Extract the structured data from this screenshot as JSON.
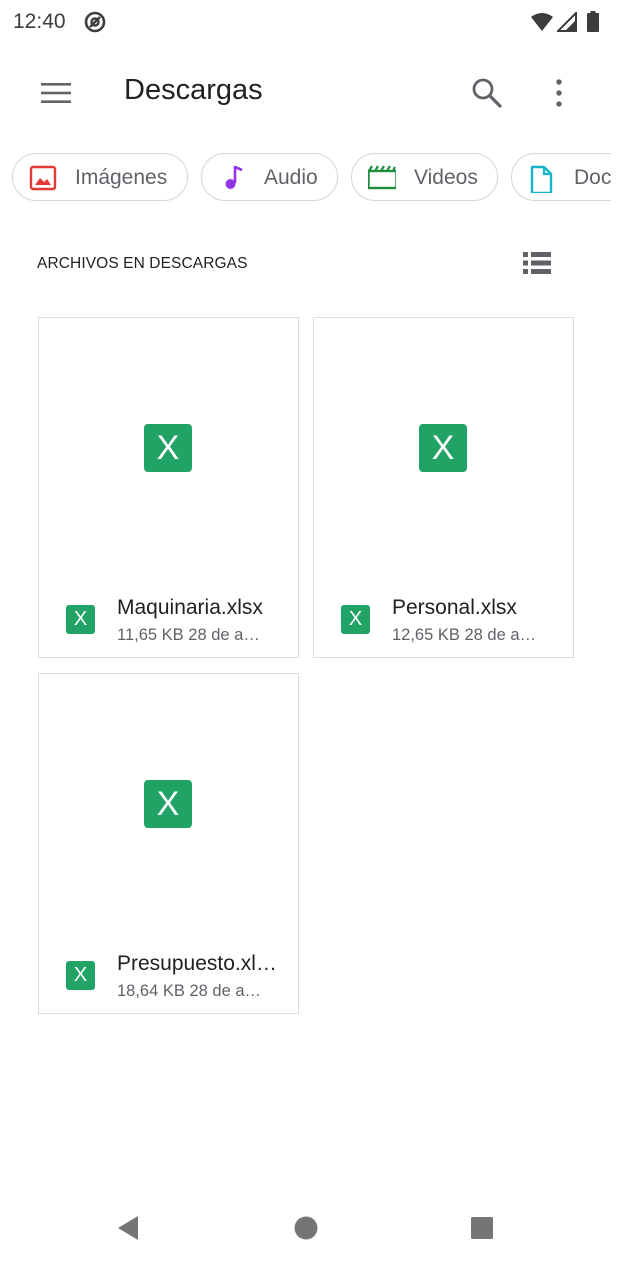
{
  "status_bar": {
    "time": "12:40",
    "icons": [
      "sync-icon",
      "wifi-icon",
      "signal-icon",
      "battery-icon"
    ]
  },
  "app_bar": {
    "title": "Descargas",
    "icons": [
      "menu-icon",
      "search-icon",
      "more-vert-icon"
    ]
  },
  "chips": [
    {
      "label": "Imágenes",
      "icon": "image-icon",
      "color": "#e53935"
    },
    {
      "label": "Audio",
      "icon": "music-note-icon",
      "color": "#9334e6"
    },
    {
      "label": "Videos",
      "icon": "movie-icon",
      "color": "#1e8e3e"
    },
    {
      "label": "Doc",
      "icon": "document-icon",
      "color": "#12b5cb"
    }
  ],
  "section": {
    "title": "ARCHIVOS EN DESCARGAS",
    "view_toggle_icon": "list-view-icon"
  },
  "files": [
    {
      "name": "Maquinaria.xlsx",
      "size": "11,65 KB",
      "date": "28 de a…",
      "icon_letter": "X"
    },
    {
      "name": "Personal.xlsx",
      "size": "12,65 KB",
      "date": "28 de a…",
      "icon_letter": "X"
    },
    {
      "name": "Presupuesto.xl…",
      "size": "18,64 KB",
      "date": "28 de a…",
      "icon_letter": "X"
    }
  ],
  "colors": {
    "excel_green": "#21a366",
    "chip_border": "#d6d6d6",
    "secondary_text": "#5f6368"
  },
  "nav_bar": {
    "icons": [
      "back-icon",
      "home-icon",
      "recents-icon"
    ]
  }
}
